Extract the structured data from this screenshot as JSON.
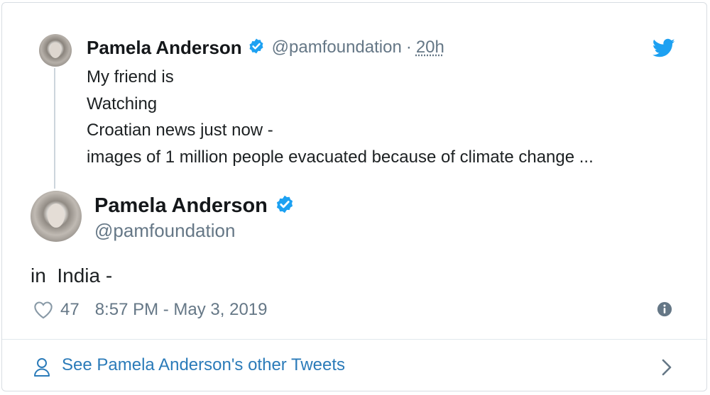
{
  "parent_tweet": {
    "name": "Pamela Anderson",
    "handle": "@pamfoundation",
    "separator": "·",
    "time": "20h",
    "lines": [
      "My friend is",
      "Watching",
      "Croatian news just now -",
      "images of 1 million people evacuated because of climate change ..."
    ]
  },
  "main_tweet": {
    "name": "Pamela Anderson",
    "handle": "@pamfoundation",
    "text": "in  India -",
    "likes": "47",
    "datetime": "8:57 PM - May 3, 2019"
  },
  "footer": {
    "link_label": "See Pamela Anderson's other Tweets"
  },
  "icons": {
    "verified": "verified-badge-icon",
    "bird": "twitter-bird-icon",
    "heart": "heart-outline-icon",
    "info": "info-icon",
    "person": "person-icon",
    "chevron": "chevron-right-icon"
  },
  "colors": {
    "twitter_blue": "#1da1f2",
    "link_blue": "#2b7bb9",
    "muted_text": "#657786",
    "text": "#1c2022",
    "border": "#d8dde2"
  }
}
